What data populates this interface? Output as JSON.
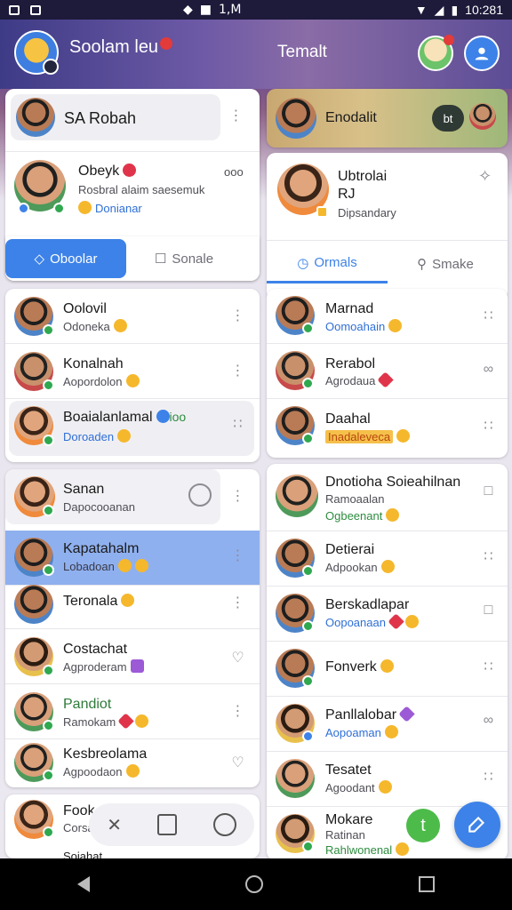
{
  "status_bar": {
    "center_text": "1,M",
    "time": "10:281"
  },
  "header": {
    "app_title": "Soolam leu",
    "right_title": "Temalt"
  },
  "left": {
    "profile": {
      "name": "SA Robah"
    },
    "featured": {
      "name": "Obeyk",
      "meta": "ooo",
      "line1": "Rosbral alaim saesemuk",
      "line2": "Donianar"
    },
    "tabs": [
      {
        "label": "Oboolar"
      },
      {
        "label": "Sonale"
      }
    ],
    "list_a": [
      {
        "name": "Oolovil",
        "sub": "Odoneka"
      },
      {
        "name": "Konalnah",
        "sub": "Aopordolon"
      },
      {
        "name": "Boaialanlamal",
        "sub": "Doroaden",
        "extra": "ioo"
      }
    ],
    "list_b": [
      {
        "name": "Sanan",
        "sub": "Dapocooanan"
      },
      {
        "name": "Kapatahalm",
        "sub": "Lobadoan"
      },
      {
        "name": "Teronala",
        "sub": ""
      },
      {
        "name": "Costachat",
        "sub": "Agproderam"
      },
      {
        "name": "Pandiot",
        "sub": "Ramokam"
      },
      {
        "name": "Kesbreolama",
        "sub": "Agpoodaon"
      }
    ],
    "list_c": [
      {
        "name": "Fook",
        "sub": "Corsa"
      },
      {
        "name": "Soiahat",
        "sub": ""
      }
    ]
  },
  "right": {
    "profile": {
      "name": "Enodalit",
      "chip": "bt"
    },
    "featured": {
      "name": "Ubtrolai",
      "name2": "RJ",
      "sub": "Dipsandary"
    },
    "tabs": [
      {
        "label": "Ormals"
      },
      {
        "label": "Smake"
      }
    ],
    "list_a": [
      {
        "name": "Marnad",
        "sub": "Oomoahain"
      },
      {
        "name": "Rerabol",
        "sub": "Agrodaua"
      },
      {
        "name": "Daahal",
        "sub": "Inadaleveca"
      }
    ],
    "list_b": [
      {
        "name": "Dnotioha Soieahilnan",
        "sub": "Ramoaalan",
        "sub2": "Ogbeenant"
      },
      {
        "name": "Detierai",
        "sub": "Adpookan"
      },
      {
        "name": "Berskadlapar",
        "sub": "Oopoanaan"
      },
      {
        "name": "Fonverk",
        "sub": ""
      },
      {
        "name": "Panllalobar",
        "sub": "Aopoaman"
      },
      {
        "name": "Tesatet",
        "sub": "Agoodant"
      },
      {
        "name": "Mokare",
        "sub": "Ratinan",
        "sub2": "Rahlwonenal"
      }
    ]
  },
  "colors": {
    "accent": "#3d82e8",
    "online": "#2fa84f",
    "selected": "#8fb0ef"
  }
}
